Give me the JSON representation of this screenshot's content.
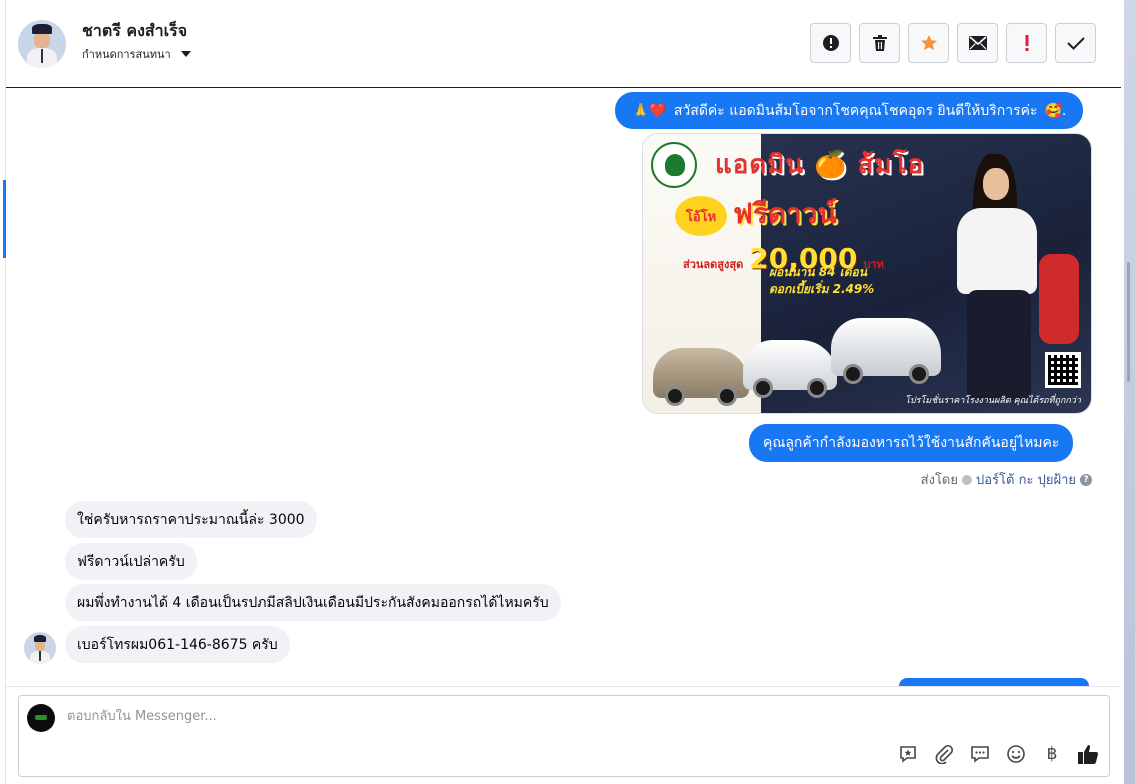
{
  "contact": {
    "name": "ชาตรี คงสำเร็จ",
    "assign_label": "กำหนดการสนทนา"
  },
  "toolbar": {
    "buttons": [
      {
        "icon": "alert-circle-icon"
      },
      {
        "icon": "trash-icon"
      },
      {
        "icon": "star-icon",
        "color": "#f7923a"
      },
      {
        "icon": "mail-icon"
      },
      {
        "icon": "exclamation-icon",
        "color": "#e41e3f"
      },
      {
        "icon": "check-icon"
      }
    ]
  },
  "messages": {
    "greeting": "สวัสดีค่ะ แอดมินส้มโอจากโชคคุณโชคอุดร ยินดีให้บริการค่ะ",
    "greeting_emoji_pre": "🙏❤️",
    "greeting_emoji_post": "🥰.",
    "promo": {
      "headline": "แอดมิน 🍊 ส้มโอ",
      "badge": "โอ้โห",
      "free": "ฟรีดาวน์",
      "discount_label": "ส่วนลดสูงสุด",
      "discount_value": "20,000",
      "discount_unit": "บาท",
      "term1": "ผ่อนนาน 84 เดือน",
      "term2": "ดอกเบี้ยเริ่ม 2.49%",
      "footer": "โปรโมชั่นราคาโรงงานผลิต คุณได้รถที่ถูกกว่า"
    },
    "question": "คุณลูกค้ากำลังมองหารถไว้ใช้งานสักคันอยู่ไหมคะ",
    "sent_by_label": "ส่งโดย",
    "sent_by_name": "ปอร์โต้ กะ ปุยฝ้าย",
    "incoming": [
      "ใช่ครับหารถราคาประมาณนี้ล่ะ 3000",
      "ฟรีดาวน์เปล่าครับ",
      "ผมพึ่งทำงานได้ 4 เดือนเป็นรปภมีสลิปเงินเดือนมีประกันสังคมออกรถได้ไหมครับ",
      "เบอร์โทรผม061-146-8675 ครับ"
    ]
  },
  "composer": {
    "placeholder": "ตอบกลับใน Messenger...",
    "tools": [
      "saved-reply-icon",
      "attachment-icon",
      "chat-bubbles-icon",
      "emoji-icon",
      "baht-icon",
      "thumbs-up-icon"
    ],
    "baht_symbol": "฿"
  }
}
